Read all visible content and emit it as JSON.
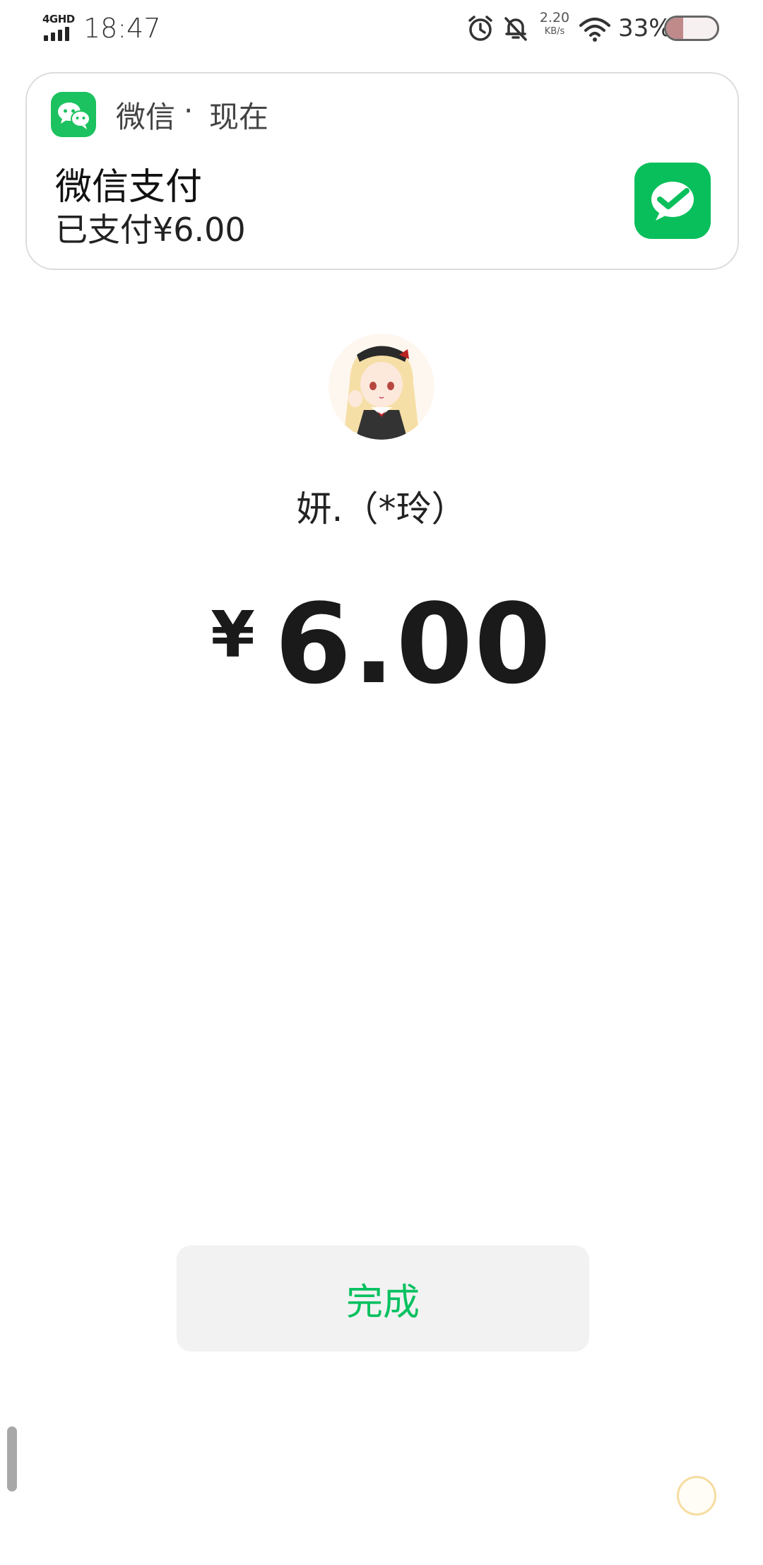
{
  "status_bar": {
    "network": "4GHD",
    "time": "18:47",
    "speed_value": "2.20",
    "speed_unit": "KB/s",
    "battery_percent": "33%",
    "battery_level": 0.33,
    "icons": [
      "alarm-icon",
      "bell-off-icon",
      "wifi-icon",
      "battery-icon",
      "signal-icon"
    ]
  },
  "notification": {
    "app_name": "微信",
    "separator": "·",
    "time": "现在",
    "title": "微信支付",
    "body": "已支付¥6.00",
    "accent_color": "#07c160"
  },
  "payment": {
    "payee": "妍.（*玲）",
    "currency": "¥",
    "amount": "6.00"
  },
  "actions": {
    "done_label": "完成"
  },
  "colors": {
    "wechat_green": "#07c160",
    "button_bg": "#f2f2f2"
  }
}
